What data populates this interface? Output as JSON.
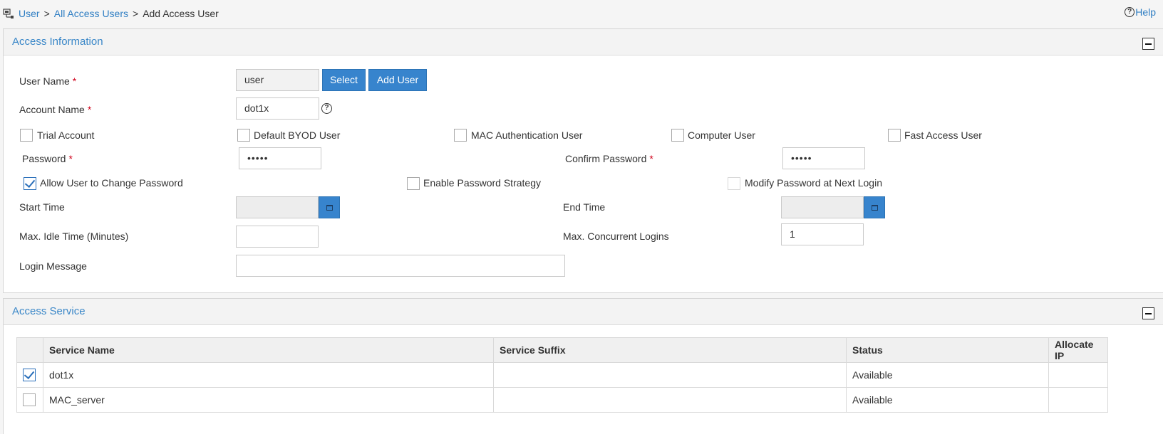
{
  "breadcrumb": {
    "items": [
      "User",
      "All Access Users"
    ],
    "sep": ">",
    "current": "Add Access User"
  },
  "help": {
    "icon": "?",
    "label": "Help"
  },
  "access_info": {
    "title": "Access Information",
    "user_name": {
      "label": "User Name",
      "required": "*",
      "value": "user",
      "select_label": "Select",
      "add_user_label": "Add User"
    },
    "account_name": {
      "label": "Account Name",
      "required": "*",
      "value": "dot1x",
      "help_icon": "?"
    },
    "account_types": [
      {
        "label": "Trial Account",
        "checked": false
      },
      {
        "label": "Default BYOD User",
        "checked": false
      },
      {
        "label": "MAC Authentication User",
        "checked": false
      },
      {
        "label": "Computer User",
        "checked": false
      },
      {
        "label": "Fast Access User",
        "checked": false
      }
    ],
    "password": {
      "label": "Password",
      "required": "*",
      "value": "•••••"
    },
    "confirm_password": {
      "label": "Confirm Password",
      "required": "*",
      "value": "•••••"
    },
    "password_options": [
      {
        "label": "Allow User to Change Password",
        "checked": true
      },
      {
        "label": "Enable Password Strategy",
        "checked": false
      },
      {
        "label": "Modify Password at Next Login",
        "checked": false,
        "disabled": true
      }
    ],
    "start_time": {
      "label": "Start Time",
      "value": ""
    },
    "end_time": {
      "label": "End Time",
      "value": ""
    },
    "max_idle": {
      "label": "Max. Idle Time (Minutes)",
      "value": ""
    },
    "max_concurrent": {
      "label": "Max. Concurrent Logins",
      "value": "1"
    },
    "login_message": {
      "label": "Login Message",
      "value": ""
    }
  },
  "access_service": {
    "title": "Access Service",
    "columns": [
      "",
      "Service Name",
      "Service Suffix",
      "Status",
      "Allocate IP"
    ],
    "rows": [
      {
        "checked": true,
        "service_name": "dot1x",
        "service_suffix": "",
        "status": "Available",
        "allocate_ip": ""
      },
      {
        "checked": false,
        "service_name": "MAC_server",
        "service_suffix": "",
        "status": "Available",
        "allocate_ip": ""
      }
    ]
  },
  "colors": {
    "accent": "#3784cd",
    "link": "#2f7ec3",
    "required": "#d0021b",
    "section_title": "#3a87c8"
  },
  "icons": [
    "user-tree-icon",
    "help-icon",
    "collapse-icon",
    "calendar-icon",
    "checkmark-icon"
  ]
}
